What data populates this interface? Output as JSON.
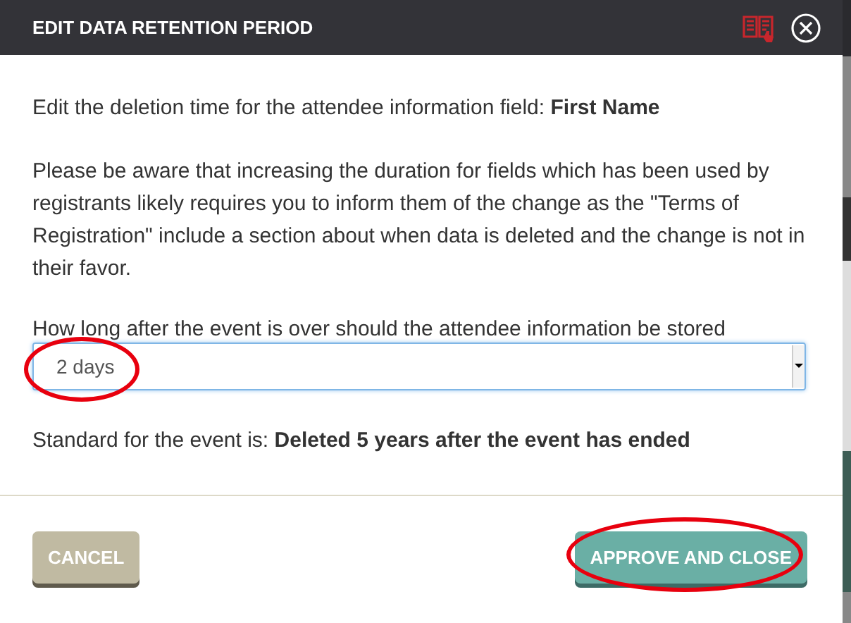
{
  "dialog": {
    "title": "EDIT DATA RETENTION PERIOD",
    "intro": "Edit the deletion time for the attendee information field: **First Name**",
    "warning": "Please be aware that increasing the duration for fields which has been used by registrants likely requires you to inform them of the change as the \"Terms of Registration\" include a section about when data is deleted and the change is not in their favor.",
    "select": {
      "label": "How long after the event is over should the attendee information be stored",
      "value": "2 days",
      "highlighted": true
    },
    "standard": "Standard for the event is: **Deleted 5 years after the event has ended**",
    "buttons": [
      {
        "label": "CANCEL",
        "kind": "secondary",
        "highlighted": false
      },
      {
        "label": "APPROVE AND CLOSE",
        "kind": "primary",
        "highlighted": true
      }
    ]
  }
}
